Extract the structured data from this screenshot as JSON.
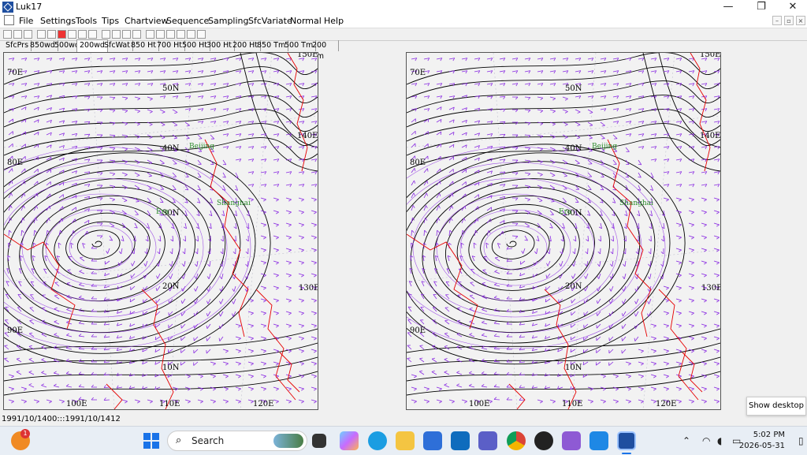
{
  "window": {
    "title": "Luk17",
    "minimize": "—",
    "restore": "❐",
    "close": "✕"
  },
  "menu": [
    "File",
    "Settings",
    "Tools",
    "Tips",
    "Chartview",
    "Sequence",
    "Sampling",
    "SfcVariate",
    "Normal",
    "Help"
  ],
  "mdi_controls": [
    "–",
    "▫",
    "×"
  ],
  "toolbar_icons": [
    "new-icon",
    "open-icon",
    "save-icon",
    "first-frame-icon",
    "prev-frame-icon",
    "stop-icon",
    "play-icon",
    "step-icon",
    "fast-forward-icon",
    "globe-icon",
    "pan-icon",
    "zoom-icon",
    "grid-icon",
    "contour-icon",
    "wind-icon",
    "streamline-icon",
    "layer-icon",
    "print-icon",
    "settings-icon"
  ],
  "tabs": [
    "SfcPrs",
    "850wd",
    "500wd",
    "200wd",
    "SfcWat",
    "850 Ht",
    "700 Ht",
    "500 Ht",
    "300 Ht",
    "200 Ht",
    "850 Tm",
    "500 Tm",
    "200 Tm"
  ],
  "active_tab": "200wd",
  "maps": {
    "left": {
      "labels": {
        "lon150": "150E",
        "lon140": "140E",
        "lon130": "130E",
        "lon120": "120E",
        "lon110": "110E",
        "lon100": "100E",
        "lon90": "90E",
        "lon80": "80E",
        "lon70": "70E",
        "lat50": "50N",
        "lat40": "40N",
        "lat30": "30N",
        "lat20": "20N",
        "lat10": "10N",
        "beijing": "Beijing",
        "shanghai": "Shanghai",
        "era": "Era"
      }
    },
    "right": {
      "labels": {
        "lon150": "150E",
        "lon140": "140E",
        "lon130": "130E",
        "lon120": "120E",
        "lon110": "110E",
        "lon100": "100E",
        "lon90": "90E",
        "lon80": "80E",
        "lon70": "70E",
        "lat50": "50N",
        "lat40": "40N",
        "lat30": "30N",
        "lat20": "20N",
        "lat10": "10N",
        "beijing": "Beijing",
        "shanghai": "Shanghai",
        "era": "Era"
      }
    }
  },
  "colors": {
    "contour": "#000000",
    "wind": "#8a2be2",
    "coast": "#e60000",
    "city": "#2a8a2a",
    "map_bg": "#f2f2f2"
  },
  "status": "1991/10/1400:::1991/10/1412",
  "tooltip": "Show desktop",
  "taskbar": {
    "search_placeholder": "Search",
    "notification_badge": "1",
    "time": "5:02 PM",
    "date": "2026-05-31"
  }
}
